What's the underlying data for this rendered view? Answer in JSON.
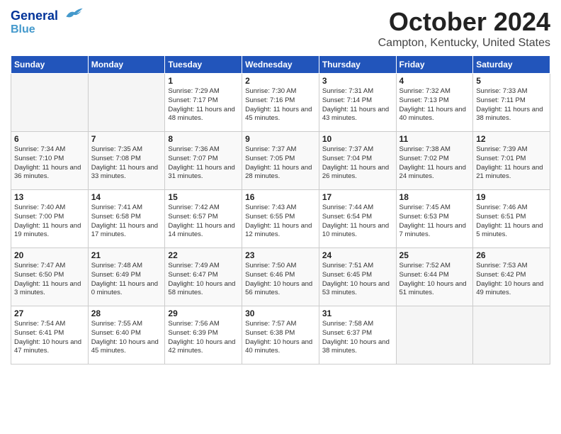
{
  "header": {
    "logo_line1": "General",
    "logo_line2": "Blue",
    "month": "October 2024",
    "location": "Campton, Kentucky, United States"
  },
  "days_of_week": [
    "Sunday",
    "Monday",
    "Tuesday",
    "Wednesday",
    "Thursday",
    "Friday",
    "Saturday"
  ],
  "weeks": [
    [
      {
        "day": "",
        "empty": true
      },
      {
        "day": "",
        "empty": true
      },
      {
        "day": "1",
        "sunrise": "Sunrise: 7:29 AM",
        "sunset": "Sunset: 7:17 PM",
        "daylight": "Daylight: 11 hours and 48 minutes."
      },
      {
        "day": "2",
        "sunrise": "Sunrise: 7:30 AM",
        "sunset": "Sunset: 7:16 PM",
        "daylight": "Daylight: 11 hours and 45 minutes."
      },
      {
        "day": "3",
        "sunrise": "Sunrise: 7:31 AM",
        "sunset": "Sunset: 7:14 PM",
        "daylight": "Daylight: 11 hours and 43 minutes."
      },
      {
        "day": "4",
        "sunrise": "Sunrise: 7:32 AM",
        "sunset": "Sunset: 7:13 PM",
        "daylight": "Daylight: 11 hours and 40 minutes."
      },
      {
        "day": "5",
        "sunrise": "Sunrise: 7:33 AM",
        "sunset": "Sunset: 7:11 PM",
        "daylight": "Daylight: 11 hours and 38 minutes."
      }
    ],
    [
      {
        "day": "6",
        "sunrise": "Sunrise: 7:34 AM",
        "sunset": "Sunset: 7:10 PM",
        "daylight": "Daylight: 11 hours and 36 minutes."
      },
      {
        "day": "7",
        "sunrise": "Sunrise: 7:35 AM",
        "sunset": "Sunset: 7:08 PM",
        "daylight": "Daylight: 11 hours and 33 minutes."
      },
      {
        "day": "8",
        "sunrise": "Sunrise: 7:36 AM",
        "sunset": "Sunset: 7:07 PM",
        "daylight": "Daylight: 11 hours and 31 minutes."
      },
      {
        "day": "9",
        "sunrise": "Sunrise: 7:37 AM",
        "sunset": "Sunset: 7:05 PM",
        "daylight": "Daylight: 11 hours and 28 minutes."
      },
      {
        "day": "10",
        "sunrise": "Sunrise: 7:37 AM",
        "sunset": "Sunset: 7:04 PM",
        "daylight": "Daylight: 11 hours and 26 minutes."
      },
      {
        "day": "11",
        "sunrise": "Sunrise: 7:38 AM",
        "sunset": "Sunset: 7:02 PM",
        "daylight": "Daylight: 11 hours and 24 minutes."
      },
      {
        "day": "12",
        "sunrise": "Sunrise: 7:39 AM",
        "sunset": "Sunset: 7:01 PM",
        "daylight": "Daylight: 11 hours and 21 minutes."
      }
    ],
    [
      {
        "day": "13",
        "sunrise": "Sunrise: 7:40 AM",
        "sunset": "Sunset: 7:00 PM",
        "daylight": "Daylight: 11 hours and 19 minutes."
      },
      {
        "day": "14",
        "sunrise": "Sunrise: 7:41 AM",
        "sunset": "Sunset: 6:58 PM",
        "daylight": "Daylight: 11 hours and 17 minutes."
      },
      {
        "day": "15",
        "sunrise": "Sunrise: 7:42 AM",
        "sunset": "Sunset: 6:57 PM",
        "daylight": "Daylight: 11 hours and 14 minutes."
      },
      {
        "day": "16",
        "sunrise": "Sunrise: 7:43 AM",
        "sunset": "Sunset: 6:55 PM",
        "daylight": "Daylight: 11 hours and 12 minutes."
      },
      {
        "day": "17",
        "sunrise": "Sunrise: 7:44 AM",
        "sunset": "Sunset: 6:54 PM",
        "daylight": "Daylight: 11 hours and 10 minutes."
      },
      {
        "day": "18",
        "sunrise": "Sunrise: 7:45 AM",
        "sunset": "Sunset: 6:53 PM",
        "daylight": "Daylight: 11 hours and 7 minutes."
      },
      {
        "day": "19",
        "sunrise": "Sunrise: 7:46 AM",
        "sunset": "Sunset: 6:51 PM",
        "daylight": "Daylight: 11 hours and 5 minutes."
      }
    ],
    [
      {
        "day": "20",
        "sunrise": "Sunrise: 7:47 AM",
        "sunset": "Sunset: 6:50 PM",
        "daylight": "Daylight: 11 hours and 3 minutes."
      },
      {
        "day": "21",
        "sunrise": "Sunrise: 7:48 AM",
        "sunset": "Sunset: 6:49 PM",
        "daylight": "Daylight: 11 hours and 0 minutes."
      },
      {
        "day": "22",
        "sunrise": "Sunrise: 7:49 AM",
        "sunset": "Sunset: 6:47 PM",
        "daylight": "Daylight: 10 hours and 58 minutes."
      },
      {
        "day": "23",
        "sunrise": "Sunrise: 7:50 AM",
        "sunset": "Sunset: 6:46 PM",
        "daylight": "Daylight: 10 hours and 56 minutes."
      },
      {
        "day": "24",
        "sunrise": "Sunrise: 7:51 AM",
        "sunset": "Sunset: 6:45 PM",
        "daylight": "Daylight: 10 hours and 53 minutes."
      },
      {
        "day": "25",
        "sunrise": "Sunrise: 7:52 AM",
        "sunset": "Sunset: 6:44 PM",
        "daylight": "Daylight: 10 hours and 51 minutes."
      },
      {
        "day": "26",
        "sunrise": "Sunrise: 7:53 AM",
        "sunset": "Sunset: 6:42 PM",
        "daylight": "Daylight: 10 hours and 49 minutes."
      }
    ],
    [
      {
        "day": "27",
        "sunrise": "Sunrise: 7:54 AM",
        "sunset": "Sunset: 6:41 PM",
        "daylight": "Daylight: 10 hours and 47 minutes."
      },
      {
        "day": "28",
        "sunrise": "Sunrise: 7:55 AM",
        "sunset": "Sunset: 6:40 PM",
        "daylight": "Daylight: 10 hours and 45 minutes."
      },
      {
        "day": "29",
        "sunrise": "Sunrise: 7:56 AM",
        "sunset": "Sunset: 6:39 PM",
        "daylight": "Daylight: 10 hours and 42 minutes."
      },
      {
        "day": "30",
        "sunrise": "Sunrise: 7:57 AM",
        "sunset": "Sunset: 6:38 PM",
        "daylight": "Daylight: 10 hours and 40 minutes."
      },
      {
        "day": "31",
        "sunrise": "Sunrise: 7:58 AM",
        "sunset": "Sunset: 6:37 PM",
        "daylight": "Daylight: 10 hours and 38 minutes."
      },
      {
        "day": "",
        "empty": true
      },
      {
        "day": "",
        "empty": true
      }
    ]
  ]
}
